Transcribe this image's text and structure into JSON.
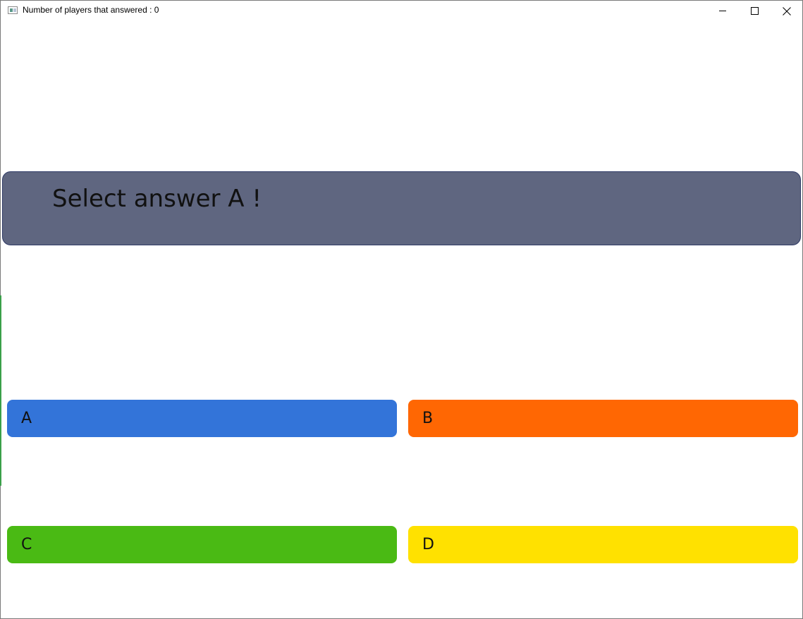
{
  "window": {
    "title": "Number of players that answered : 0",
    "controls": {
      "minimize": "minimize-icon",
      "maximize": "maximize-icon",
      "close": "close-icon"
    }
  },
  "question": {
    "text": "Select answer A !",
    "background_color": "#5f6680"
  },
  "answers": [
    {
      "label": "A",
      "color": "#3374d9"
    },
    {
      "label": "B",
      "color": "#ff6703"
    },
    {
      "label": "C",
      "color": "#4aba14"
    },
    {
      "label": "D",
      "color": "#ffe100"
    }
  ]
}
